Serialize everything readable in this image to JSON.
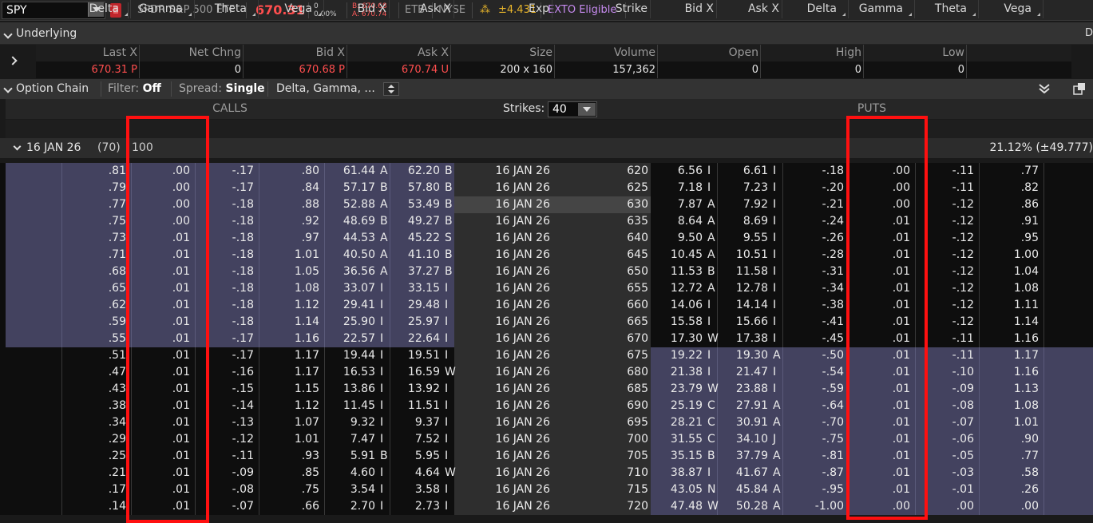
{
  "header": {
    "symbol": "SPY",
    "description": "SPDR S&P 500 ETF",
    "last": "670.31",
    "net_change": "0",
    "net_change_pct": "0.00%",
    "bid": "B: 670.68",
    "ask": "A: 670.74",
    "etb": "ETB",
    "exchange": "NYSE",
    "expected_move": "±4.431",
    "exto": "EXTO Eligible"
  },
  "underlying": {
    "label": "Underlying",
    "columns": [
      "Last X",
      "Net Chng",
      "Bid X",
      "Ask X",
      "Size",
      "Volume",
      "Open",
      "High",
      "Low"
    ],
    "values": {
      "last": "670.31",
      "last_x": "P",
      "net_chng": "0",
      "bid": "670.68",
      "bid_x": "P",
      "ask": "670.74",
      "ask_x": "U",
      "size": "200 x 160",
      "volume": "157,362",
      "open": "0",
      "high": "0",
      "low": "0"
    },
    "edge_letter": "D"
  },
  "option_chain": {
    "label": "Option Chain",
    "filter_label": "Filter:",
    "filter_value": "Off",
    "spread_label": "Spread:",
    "spread_value": "Single",
    "layout": "Delta, Gamma, ..."
  },
  "groups": {
    "calls": "CALLS",
    "puts": "PUTS",
    "strikes_label": "Strikes:",
    "strikes_value": "40"
  },
  "columns": {
    "calls": [
      "Delta",
      "Gamma",
      "Theta",
      "Vega",
      "Bid X",
      "Ask X"
    ],
    "mid": [
      "Exp",
      "Strike"
    ],
    "puts": [
      "Bid X",
      "Ask X",
      "Delta",
      "Gamma",
      "Theta",
      "Vega"
    ]
  },
  "expiry_row": {
    "label": "16 JAN 26",
    "count": "(70)",
    "extra": "100",
    "iv": "21.12% (±49.777)"
  },
  "rows": [
    {
      "cd": ".81",
      "cg": ".00",
      "ct": "-.17",
      "cv": ".80",
      "cb": "61.44",
      "cbx": "A",
      "ca": "62.20",
      "cax": "B",
      "exp": "16 JAN 26",
      "k": "620",
      "pb": "6.56",
      "pbx": "I",
      "pa": "6.61",
      "pax": "I",
      "pd": "-.18",
      "pg": ".00",
      "pt": "-.11",
      "pv": ".77"
    },
    {
      "cd": ".79",
      "cg": ".00",
      "ct": "-.17",
      "cv": ".84",
      "cb": "57.17",
      "cbx": "B",
      "ca": "57.80",
      "cax": "B",
      "exp": "16 JAN 26",
      "k": "625",
      "pb": "7.18",
      "pbx": "I",
      "pa": "7.23",
      "pax": "I",
      "pd": "-.20",
      "pg": ".00",
      "pt": "-.11",
      "pv": ".82"
    },
    {
      "cd": ".77",
      "cg": ".00",
      "ct": "-.18",
      "cv": ".88",
      "cb": "52.88",
      "cbx": "A",
      "ca": "53.49",
      "cax": "B",
      "exp": "16 JAN 26",
      "k": "630",
      "pb": "7.87",
      "pbx": "A",
      "pa": "7.92",
      "pax": "I",
      "pd": "-.21",
      "pg": ".00",
      "pt": "-.12",
      "pv": ".86"
    },
    {
      "cd": ".75",
      "cg": ".00",
      "ct": "-.18",
      "cv": ".92",
      "cb": "48.69",
      "cbx": "B",
      "ca": "49.27",
      "cax": "B",
      "exp": "16 JAN 26",
      "k": "635",
      "pb": "8.64",
      "pbx": "A",
      "pa": "8.69",
      "pax": "I",
      "pd": "-.24",
      "pg": ".01",
      "pt": "-.12",
      "pv": ".91"
    },
    {
      "cd": ".73",
      "cg": ".01",
      "ct": "-.18",
      "cv": ".97",
      "cb": "44.53",
      "cbx": "A",
      "ca": "45.22",
      "cax": "S",
      "exp": "16 JAN 26",
      "k": "640",
      "pb": "9.50",
      "pbx": "A",
      "pa": "9.55",
      "pax": "I",
      "pd": "-.26",
      "pg": ".01",
      "pt": "-.12",
      "pv": ".95"
    },
    {
      "cd": ".71",
      "cg": ".01",
      "ct": "-.18",
      "cv": "1.01",
      "cb": "40.50",
      "cbx": "A",
      "ca": "41.10",
      "cax": "B",
      "exp": "16 JAN 26",
      "k": "645",
      "pb": "10.45",
      "pbx": "A",
      "pa": "10.51",
      "pax": "I",
      "pd": "-.28",
      "pg": ".01",
      "pt": "-.12",
      "pv": "1.00"
    },
    {
      "cd": ".68",
      "cg": ".01",
      "ct": "-.18",
      "cv": "1.05",
      "cb": "36.56",
      "cbx": "A",
      "ca": "37.27",
      "cax": "B",
      "exp": "16 JAN 26",
      "k": "650",
      "pb": "11.53",
      "pbx": "B",
      "pa": "11.58",
      "pax": "I",
      "pd": "-.31",
      "pg": ".01",
      "pt": "-.12",
      "pv": "1.04"
    },
    {
      "cd": ".65",
      "cg": ".01",
      "ct": "-.18",
      "cv": "1.08",
      "cb": "33.07",
      "cbx": "I",
      "ca": "33.15",
      "cax": "I",
      "exp": "16 JAN 26",
      "k": "655",
      "pb": "12.72",
      "pbx": "A",
      "pa": "12.78",
      "pax": "I",
      "pd": "-.34",
      "pg": ".01",
      "pt": "-.12",
      "pv": "1.08"
    },
    {
      "cd": ".62",
      "cg": ".01",
      "ct": "-.18",
      "cv": "1.12",
      "cb": "29.41",
      "cbx": "I",
      "ca": "29.48",
      "cax": "I",
      "exp": "16 JAN 26",
      "k": "660",
      "pb": "14.06",
      "pbx": "I",
      "pa": "14.14",
      "pax": "I",
      "pd": "-.38",
      "pg": ".01",
      "pt": "-.12",
      "pv": "1.11"
    },
    {
      "cd": ".59",
      "cg": ".01",
      "ct": "-.18",
      "cv": "1.14",
      "cb": "25.90",
      "cbx": "I",
      "ca": "25.97",
      "cax": "I",
      "exp": "16 JAN 26",
      "k": "665",
      "pb": "15.58",
      "pbx": "I",
      "pa": "15.66",
      "pax": "I",
      "pd": "-.41",
      "pg": ".01",
      "pt": "-.12",
      "pv": "1.14"
    },
    {
      "cd": ".55",
      "cg": ".01",
      "ct": "-.17",
      "cv": "1.16",
      "cb": "22.57",
      "cbx": "I",
      "ca": "22.64",
      "cax": "I",
      "exp": "16 JAN 26",
      "k": "670",
      "pb": "17.30",
      "pbx": "W",
      "pa": "17.38",
      "pax": "I",
      "pd": "-.45",
      "pg": ".01",
      "pt": "-.11",
      "pv": "1.16"
    },
    {
      "cd": ".51",
      "cg": ".01",
      "ct": "-.17",
      "cv": "1.17",
      "cb": "19.44",
      "cbx": "I",
      "ca": "19.51",
      "cax": "I",
      "exp": "16 JAN 26",
      "k": "675",
      "pb": "19.22",
      "pbx": "I",
      "pa": "19.30",
      "pax": "A",
      "pd": "-.50",
      "pg": ".01",
      "pt": "-.11",
      "pv": "1.17"
    },
    {
      "cd": ".47",
      "cg": ".01",
      "ct": "-.16",
      "cv": "1.17",
      "cb": "16.53",
      "cbx": "I",
      "ca": "16.59",
      "cax": "W",
      "exp": "16 JAN 26",
      "k": "680",
      "pb": "21.38",
      "pbx": "I",
      "pa": "21.47",
      "pax": "I",
      "pd": "-.54",
      "pg": ".01",
      "pt": "-.10",
      "pv": "1.16"
    },
    {
      "cd": ".43",
      "cg": ".01",
      "ct": "-.15",
      "cv": "1.15",
      "cb": "13.86",
      "cbx": "I",
      "ca": "13.92",
      "cax": "I",
      "exp": "16 JAN 26",
      "k": "685",
      "pb": "23.79",
      "pbx": "W",
      "pa": "23.88",
      "pax": "I",
      "pd": "-.59",
      "pg": ".01",
      "pt": "-.09",
      "pv": "1.13"
    },
    {
      "cd": ".38",
      "cg": ".01",
      "ct": "-.14",
      "cv": "1.12",
      "cb": "11.45",
      "cbx": "I",
      "ca": "11.51",
      "cax": "I",
      "exp": "16 JAN 26",
      "k": "690",
      "pb": "25.19",
      "pbx": "C",
      "pa": "27.91",
      "pax": "A",
      "pd": "-.64",
      "pg": ".01",
      "pt": "-.08",
      "pv": "1.08"
    },
    {
      "cd": ".34",
      "cg": ".01",
      "ct": "-.13",
      "cv": "1.07",
      "cb": "9.32",
      "cbx": "I",
      "ca": "9.37",
      "cax": "I",
      "exp": "16 JAN 26",
      "k": "695",
      "pb": "28.21",
      "pbx": "C",
      "pa": "30.91",
      "pax": "A",
      "pd": "-.70",
      "pg": ".01",
      "pt": "-.07",
      "pv": "1.01"
    },
    {
      "cd": ".29",
      "cg": ".01",
      "ct": "-.12",
      "cv": "1.01",
      "cb": "7.47",
      "cbx": "I",
      "ca": "7.52",
      "cax": "I",
      "exp": "16 JAN 26",
      "k": "700",
      "pb": "31.55",
      "pbx": "C",
      "pa": "34.10",
      "pax": "J",
      "pd": "-.75",
      "pg": ".01",
      "pt": "-.06",
      "pv": ".90"
    },
    {
      "cd": ".25",
      "cg": ".01",
      "ct": "-.11",
      "cv": ".93",
      "cb": "5.91",
      "cbx": "B",
      "ca": "5.95",
      "cax": "I",
      "exp": "16 JAN 26",
      "k": "705",
      "pb": "35.15",
      "pbx": "B",
      "pa": "37.79",
      "pax": "A",
      "pd": "-.81",
      "pg": ".01",
      "pt": "-.05",
      "pv": ".77"
    },
    {
      "cd": ".21",
      "cg": ".01",
      "ct": "-.09",
      "cv": ".85",
      "cb": "4.60",
      "cbx": "I",
      "ca": "4.64",
      "cax": "W",
      "exp": "16 JAN 26",
      "k": "710",
      "pb": "38.87",
      "pbx": "I",
      "pa": "41.67",
      "pax": "A",
      "pd": "-.87",
      "pg": ".01",
      "pt": "-.03",
      "pv": ".58"
    },
    {
      "cd": ".17",
      "cg": ".01",
      "ct": "-.08",
      "cv": ".75",
      "cb": "3.54",
      "cbx": "I",
      "ca": "3.58",
      "cax": "I",
      "exp": "16 JAN 26",
      "k": "715",
      "pb": "43.05",
      "pbx": "N",
      "pa": "45.84",
      "pax": "A",
      "pd": "-.95",
      "pg": ".01",
      "pt": "-.01",
      "pv": ".26"
    },
    {
      "cd": ".14",
      "cg": ".01",
      "ct": "-.07",
      "cv": ".66",
      "cb": "2.70",
      "cbx": "I",
      "ca": "2.73",
      "cax": "I",
      "exp": "16 JAN 26",
      "k": "720",
      "pb": "47.48",
      "pbx": "W",
      "pa": "50.28",
      "pax": "A",
      "pd": "-1.00",
      "pg": ".00",
      "pt": ".00",
      "pv": ".00"
    }
  ]
}
